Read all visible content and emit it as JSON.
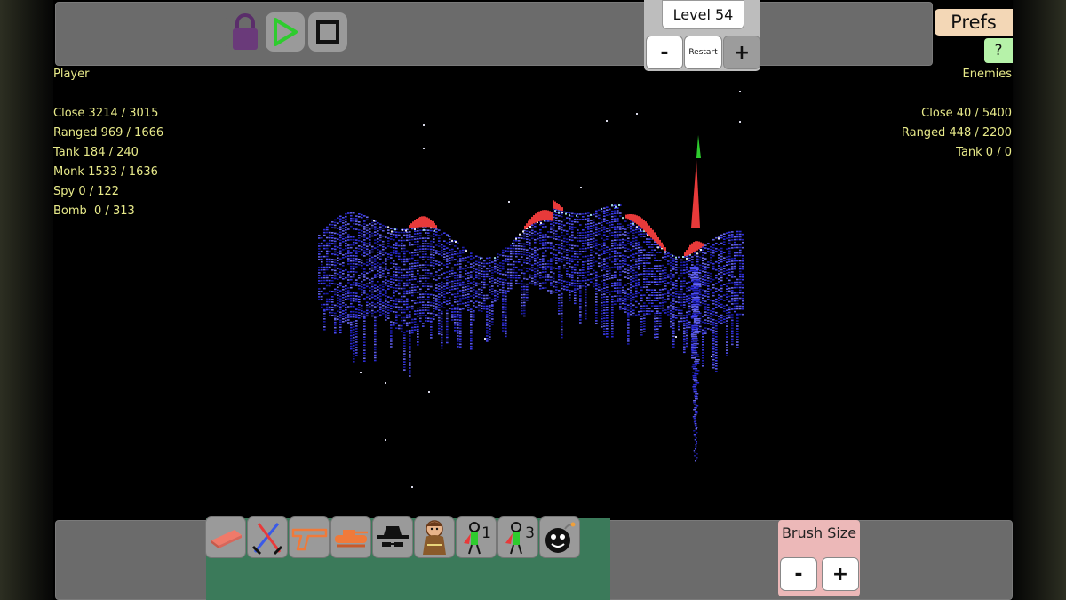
{
  "top_toolbar": {
    "lock_icon": "padlock-icon",
    "play_icon": "play-icon",
    "stop_icon": "stop-icon"
  },
  "level": {
    "label": "Level 54",
    "minus": "-",
    "restart": "Restart",
    "plus": "+"
  },
  "prefs": {
    "label": "Prefs"
  },
  "help": {
    "label": "?"
  },
  "player": {
    "title": "Player",
    "stats": [
      "Close 3214 / 3015",
      "Ranged 969 / 1666",
      "Tank 184 / 240",
      "Monk 1533 / 1636",
      "Spy 0 / 122",
      "Bomb  0 / 313"
    ]
  },
  "enemies": {
    "title": "Enemies",
    "stats": [
      "Close 40 / 5400",
      "Ranged 448 / 2200",
      "Tank 0 / 0"
    ]
  },
  "unit_palette": [
    {
      "name": "eraser-icon"
    },
    {
      "name": "crossed-swords-icon"
    },
    {
      "name": "pistol-icon"
    },
    {
      "name": "tank-icon"
    },
    {
      "name": "spy-hat-icon"
    },
    {
      "name": "monk-icon"
    },
    {
      "name": "unit-one-icon",
      "label": "1"
    },
    {
      "name": "unit-three-icon",
      "label": "3"
    },
    {
      "name": "bomb-icon"
    }
  ],
  "brush": {
    "label": "Brush Size",
    "minus": "-",
    "plus": "+"
  },
  "colors": {
    "player_units": "#3a3ae8",
    "enemy_units": "#e83a3a",
    "stat_text": "#e8ea8a",
    "play_green": "#2ecc2e",
    "panel_green": "#3b7a5a"
  }
}
